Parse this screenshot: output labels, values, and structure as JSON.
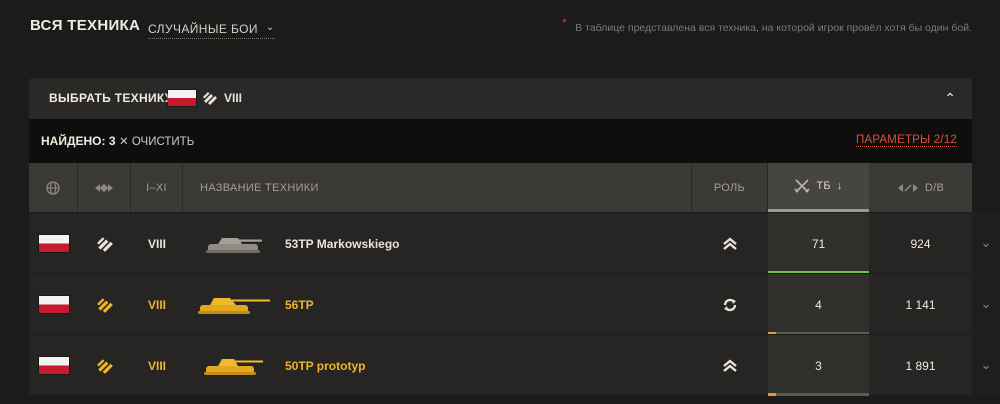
{
  "header": {
    "title": "ВСЯ ТЕХНИКА",
    "mode": "СЛУЧАЙНЫЕ БОИ",
    "note_star": "*",
    "note": "В таблице представлена вся техника, на которой игрок провёл хотя бы один бой."
  },
  "filter_panel": {
    "label": "ВЫБРАТЬ ТЕХНИКУ",
    "nation_icon": "poland-flag",
    "type_icon": "medium-tank-icon",
    "tier": "VIII",
    "collapse_icon": "chevron-up-icon"
  },
  "filter_bar": {
    "found": "НАЙДЕНО: 3",
    "clear": "ОЧИСТИТЬ",
    "clear_icon": "close-icon",
    "params": "ПАРАМЕТРЫ 2/12"
  },
  "columns": {
    "nation_icon": "globe-icon",
    "type_icon": "vehicle-type-icon",
    "tier": "I–XI",
    "name": "НАЗВАНИЕ ТЕХНИКИ",
    "role": "РОЛЬ",
    "battles": "ТБ",
    "battles_icon": "crossed-swords-icon",
    "sort_icon": "sort-down-icon",
    "damage": "D/B",
    "damage_icon": "damage-arrows-icon"
  },
  "colors": {
    "accent_red": "#d9503e",
    "premium_gold": "#f0b429",
    "regular_text": "#e9e4d9",
    "progress_green": "#6fbf4a",
    "progress_orange": "#e79a2a"
  },
  "rows": [
    {
      "nation": "poland-flag",
      "type_icon": "medium-tank-icon",
      "tier": "VIII",
      "name": "53TP Markowskiego",
      "premium": false,
      "role_icon": "assault-role-icon",
      "battles": "71",
      "battles_progress": 1.0,
      "damage": "924"
    },
    {
      "nation": "poland-flag",
      "type_icon": "medium-tank-icon",
      "tier": "VIII",
      "name": "56TP",
      "premium": true,
      "role_icon": "versatile-role-icon",
      "battles": "4",
      "battles_progress": 0.06,
      "damage": "1 141"
    },
    {
      "nation": "poland-flag",
      "type_icon": "medium-tank-icon",
      "tier": "VIII",
      "name": "50TP prototyp",
      "premium": true,
      "role_icon": "assault-role-icon",
      "battles": "3",
      "battles_progress": 0.04,
      "damage": "1 891"
    }
  ]
}
